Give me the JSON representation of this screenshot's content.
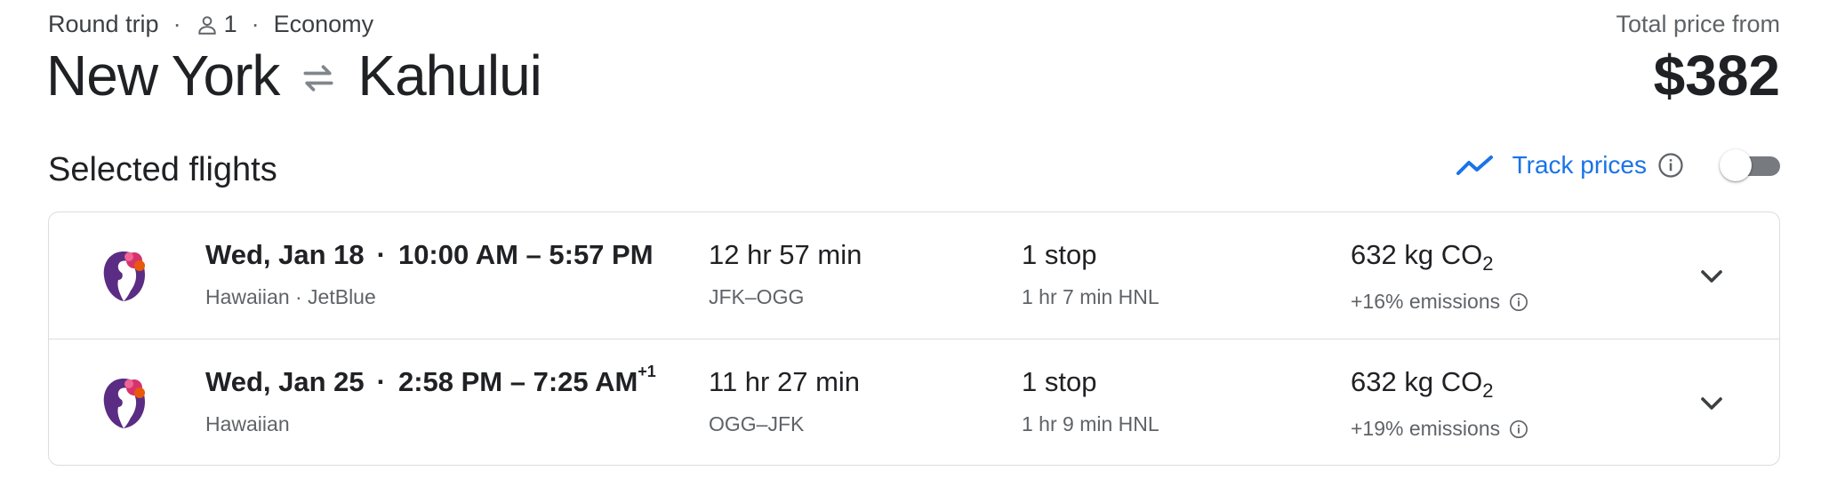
{
  "header": {
    "trip_type": "Round trip",
    "passengers": "1",
    "cabin": "Economy",
    "origin": "New York",
    "destination": "Kahului",
    "price_label": "Total price from",
    "price": "$382"
  },
  "section": {
    "title": "Selected flights",
    "track_prices_label": "Track prices",
    "track_prices_enabled": false
  },
  "flights": [
    {
      "date": "Wed, Jan 18",
      "time_range": "10:00 AM – 5:57 PM",
      "day_offset": "",
      "airlines": "Hawaiian · JetBlue",
      "duration": "12 hr 57 min",
      "route": "JFK–OGG",
      "stops": "1 stop",
      "layover": "1 hr 7 min HNL",
      "co2_prefix": "632 kg CO",
      "co2_subscript": "2",
      "emissions": "+16% emissions"
    },
    {
      "date": "Wed, Jan 25",
      "time_range": "2:58 PM – 7:25 AM",
      "day_offset": "+1",
      "airlines": "Hawaiian",
      "duration": "11 hr 27 min",
      "route": "OGG–JFK",
      "stops": "1 stop",
      "layover": "1 hr 9 min HNL",
      "co2_prefix": "632 kg CO",
      "co2_subscript": "2",
      "emissions": "+19% emissions"
    }
  ],
  "icons": {
    "person": "person-icon",
    "swap": "swap-arrows-icon",
    "trend": "trending-up-icon",
    "info": "info-icon",
    "chevron": "chevron-down-icon",
    "airline_logo": "hawaiian-airlines-logo"
  },
  "colors": {
    "accent": "#1a73e8",
    "text": "#202124",
    "muted": "#5f6368",
    "border": "#dadce0",
    "logo_purple": "#5b2c83",
    "logo_pink": "#d6336c"
  }
}
